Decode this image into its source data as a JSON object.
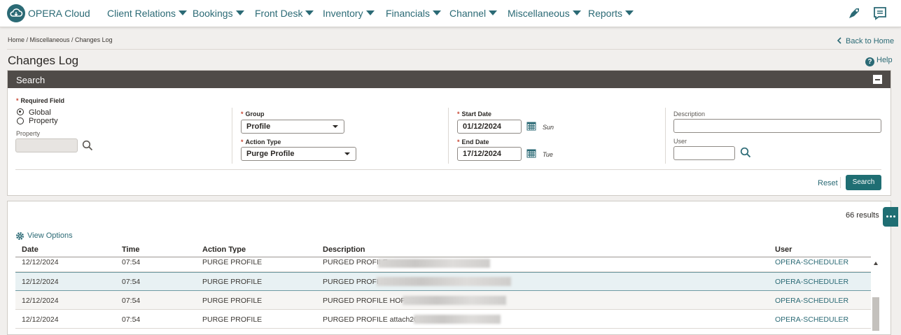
{
  "app": {
    "logo_text": "OPERA Cloud"
  },
  "nav": {
    "items": [
      {
        "label": "Client Relations"
      },
      {
        "label": "Bookings"
      },
      {
        "label": "Front Desk"
      },
      {
        "label": "Inventory"
      },
      {
        "label": "Financials"
      },
      {
        "label": "Channel"
      },
      {
        "label": "Miscellaneous"
      },
      {
        "label": "Reports"
      }
    ]
  },
  "breadcrumb": "Home / Miscellaneous / Changes Log",
  "page": {
    "title": "Changes Log",
    "back_label": "Back to Home",
    "help_label": "Help"
  },
  "search": {
    "title": "Search",
    "required_label": "Required Field",
    "scope_global": "Global",
    "scope_property": "Property",
    "scope_selected": "Global",
    "property_label": "Property",
    "property_value": "",
    "group_label": "Group",
    "group_value": "Profile",
    "action_type_label": "Action Type",
    "action_type_value": "Purge Profile",
    "start_date_label": "Start Date",
    "start_date_value": "01/12/2024",
    "start_day": "Sun",
    "end_date_label": "End Date",
    "end_date_value": "17/12/2024",
    "end_day": "Tue",
    "description_label": "Description",
    "description_value": "",
    "user_label": "User",
    "user_value": "",
    "reset_label": "Reset",
    "search_label": "Search"
  },
  "results": {
    "count_text": "66 results",
    "view_options_label": "View Options",
    "columns": {
      "date": "Date",
      "time": "Time",
      "action_type": "Action Type",
      "description": "Description",
      "user": "User"
    },
    "rows": [
      {
        "date": "12/12/2024",
        "time": "07:54",
        "action_type": "PURGE PROFILE",
        "description": "PURGED PROFILE",
        "user": "OPERA-SCHEDULER"
      },
      {
        "date": "12/12/2024",
        "time": "07:54",
        "action_type": "PURGE PROFILE",
        "description": "PURGED PROFILE",
        "user": "OPERA-SCHEDULER"
      },
      {
        "date": "12/12/2024",
        "time": "07:54",
        "action_type": "PURGE PROFILE",
        "description": "PURGED PROFILE HOPCS",
        "user": "OPERA-SCHEDULER"
      },
      {
        "date": "12/12/2024",
        "time": "07:54",
        "action_type": "PURGE PROFILE",
        "description": "PURGED PROFILE attach2011",
        "user": "OPERA-SCHEDULER"
      }
    ]
  },
  "colors": {
    "accent": "#2b6a75",
    "header_bar": "#4f4b48",
    "button": "#1f6e73",
    "required": "#c74634"
  }
}
